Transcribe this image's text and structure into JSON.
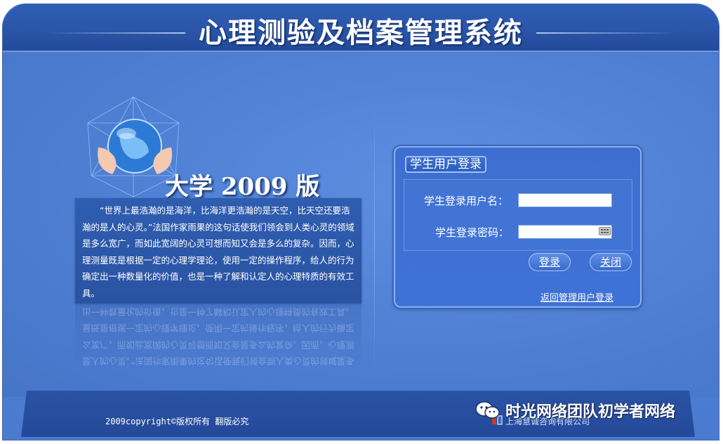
{
  "header": {
    "title": "心理测验及档案管理系统"
  },
  "edition": {
    "label": "大学 2009 版"
  },
  "intro": {
    "text": "“世界上最浩瀚的是海洋，比海洋更浩瀚的是天空，比天空还要浩瀚的是人的心灵。”法国作家雨果的这句话使我们领会到人类心灵的领域是多么宽广，而如此宽阔的心灵可想而知又会是多么的复杂。因而，心理测量既是根据一定的心理学理论，使用一定的操作程序，给人的行为确定出一种数量化的价值，也是一种了解和认定人的心理特质的有效工具。"
  },
  "login": {
    "title": "学生用户登录",
    "username_label": "学生登录用户名：",
    "username_value": "",
    "password_label": "学生登录密码：",
    "password_value": "",
    "login_button": "登录",
    "close_button": "关闭",
    "back_link": "返回管理用户登录"
  },
  "footer": {
    "copyright": "2009copyright©版权所有 翻版必究",
    "company": "上海慧诚咨询有限公司",
    "watermark": "时光网络团队初学者网络"
  },
  "colors": {
    "background": "#4d7fd2",
    "header": "#2b55a8",
    "panel": "#3f72d6",
    "text": "#ffffff"
  }
}
